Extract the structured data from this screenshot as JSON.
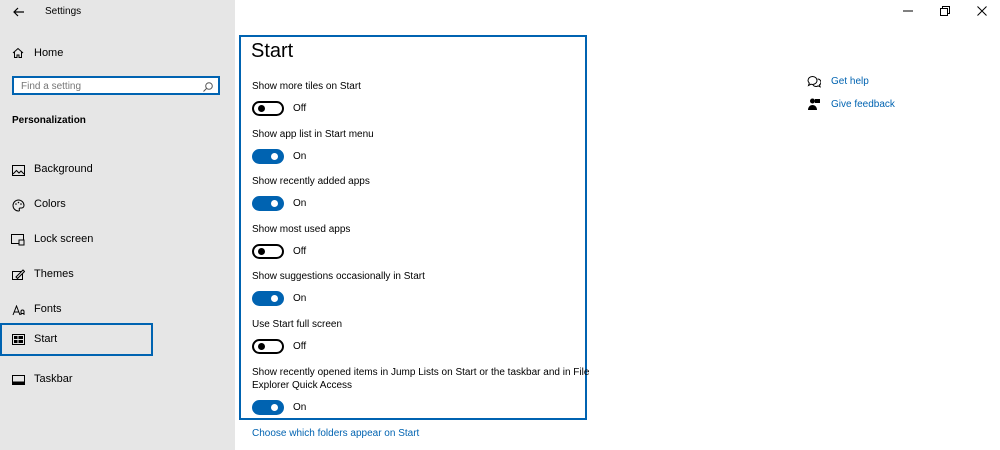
{
  "window": {
    "app_title": "Settings"
  },
  "sidebar": {
    "home_label": "Home",
    "search_placeholder": "Find a setting",
    "section_title": "Personalization",
    "items": [
      {
        "label": "Background",
        "icon": "picture-icon"
      },
      {
        "label": "Colors",
        "icon": "palette-icon"
      },
      {
        "label": "Lock screen",
        "icon": "lock-screen-icon"
      },
      {
        "label": "Themes",
        "icon": "themes-icon"
      },
      {
        "label": "Fonts",
        "icon": "fonts-icon"
      },
      {
        "label": "Start",
        "icon": "start-icon",
        "selected": true
      },
      {
        "label": "Taskbar",
        "icon": "taskbar-icon"
      }
    ]
  },
  "main": {
    "title": "Start",
    "settings": [
      {
        "label": "Show more tiles on Start",
        "state": "Off",
        "on": false
      },
      {
        "label": "Show app list in Start menu",
        "state": "On",
        "on": true
      },
      {
        "label": "Show recently added apps",
        "state": "On",
        "on": true
      },
      {
        "label": "Show most used apps",
        "state": "Off",
        "on": false
      },
      {
        "label": "Show suggestions occasionally in Start",
        "state": "On",
        "on": true
      },
      {
        "label": "Use Start full screen",
        "state": "Off",
        "on": false
      },
      {
        "label": "Show recently opened items in Jump Lists on Start or the taskbar and in File Explorer Quick Access",
        "state": "On",
        "on": true
      }
    ],
    "folders_link": "Choose which folders appear on Start"
  },
  "help": {
    "get_help": "Get help",
    "give_feedback": "Give feedback"
  },
  "colors": {
    "accent": "#0063b1",
    "sidebar_bg": "#e6e6e6"
  }
}
